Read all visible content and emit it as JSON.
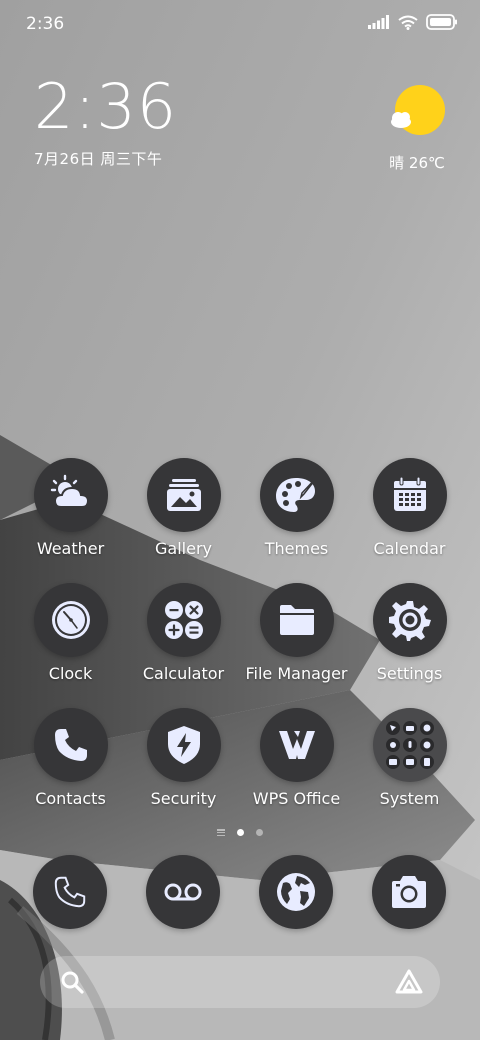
{
  "status_bar": {
    "time": "2:36"
  },
  "clock_widget": {
    "time": "2:36",
    "date": "7月26日 周三下午"
  },
  "weather_widget": {
    "text": "晴 26℃",
    "sun_color": "#FFD21A"
  },
  "apps": [
    {
      "label": "Weather",
      "icon": "weather-icon"
    },
    {
      "label": "Gallery",
      "icon": "gallery-icon"
    },
    {
      "label": "Themes",
      "icon": "palette-icon"
    },
    {
      "label": "Calendar",
      "icon": "calendar-icon"
    },
    {
      "label": "Clock",
      "icon": "clock-icon"
    },
    {
      "label": "Calculator",
      "icon": "calculator-icon"
    },
    {
      "label": "File Manager",
      "icon": "folder-icon"
    },
    {
      "label": "Settings",
      "icon": "gear-icon"
    },
    {
      "label": "Contacts",
      "icon": "phone-icon"
    },
    {
      "label": "Security",
      "icon": "shield-icon"
    },
    {
      "label": "WPS Office",
      "icon": "wps-icon"
    },
    {
      "label": "System",
      "icon": "folder-grid-icon"
    }
  ],
  "dock": [
    {
      "icon": "phone-icon"
    },
    {
      "icon": "voicemail-icon"
    },
    {
      "icon": "globe-icon"
    },
    {
      "icon": "camera-icon"
    }
  ],
  "page_indicator": {
    "pages": 2,
    "active": 1
  },
  "colors": {
    "icon_bg": "#363638",
    "icon_fg": "#E8ECFF"
  }
}
